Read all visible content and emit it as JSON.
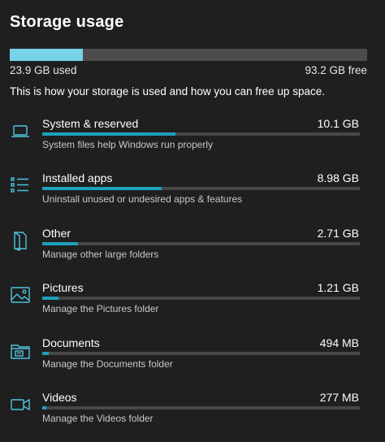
{
  "page": {
    "title": "Storage usage",
    "description": "This is how your storage is used and how you can free up space."
  },
  "summary": {
    "used_label": "23.9 GB used",
    "free_label": "93.2 GB free",
    "used_fraction": 0.204
  },
  "categories": [
    {
      "name": "System & reserved",
      "size": "10.1 GB",
      "description": "System files help Windows run properly",
      "icon": "laptop-icon",
      "usage_fraction": 0.42
    },
    {
      "name": "Installed apps",
      "size": "8.98 GB",
      "description": "Uninstall unused or undesired apps & features",
      "icon": "app-list-icon",
      "usage_fraction": 0.375
    },
    {
      "name": "Other",
      "size": "2.71 GB",
      "description": "Manage other large folders",
      "icon": "folder-document-icon",
      "usage_fraction": 0.113
    },
    {
      "name": "Pictures",
      "size": "1.21 GB",
      "description": "Manage the Pictures folder",
      "icon": "picture-icon",
      "usage_fraction": 0.05
    },
    {
      "name": "Documents",
      "size": "494 MB",
      "description": "Manage the Documents folder",
      "icon": "documents-folder-icon",
      "usage_fraction": 0.02
    },
    {
      "name": "Videos",
      "size": "277 MB",
      "description": "Manage the Videos folder",
      "icon": "video-camera-icon",
      "usage_fraction": 0.012
    }
  ],
  "colors": {
    "background": "#1f1f1f",
    "accent": "#76d3e8",
    "accent_dark": "#1ea0be",
    "bar_track": "#4d4d4d"
  }
}
